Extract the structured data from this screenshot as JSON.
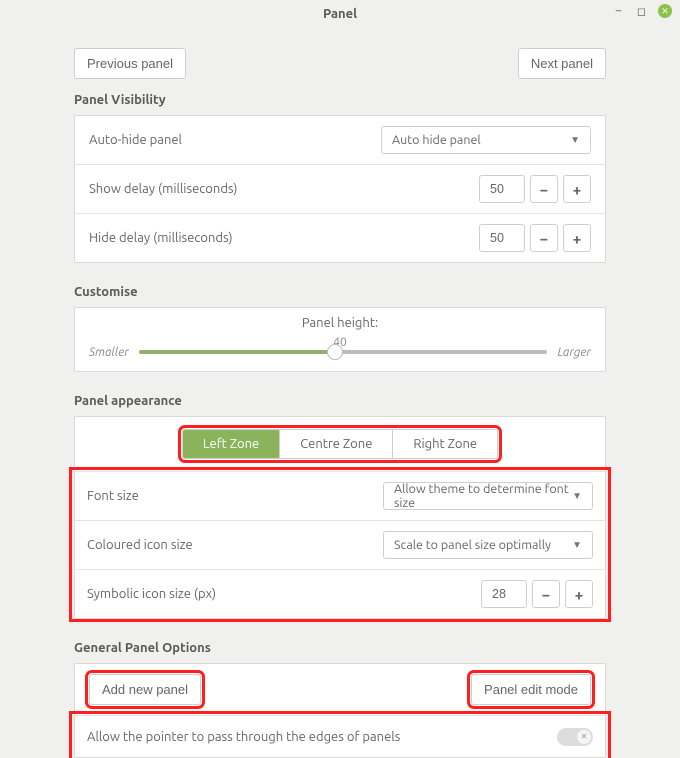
{
  "window": {
    "title": "Panel"
  },
  "nav": {
    "prev": "Previous panel",
    "next": "Next panel"
  },
  "visibility": {
    "heading": "Panel Visibility",
    "autohide_label": "Auto-hide panel",
    "autohide_value": "Auto hide panel",
    "show_delay_label": "Show delay (milliseconds)",
    "show_delay_value": "50",
    "hide_delay_label": "Hide delay (milliseconds)",
    "hide_delay_value": "50"
  },
  "customise": {
    "heading": "Customise",
    "slider_title": "Panel height:",
    "slider_value": "40",
    "smaller": "Smaller",
    "larger": "Larger"
  },
  "appearance": {
    "heading": "Panel appearance",
    "tabs": {
      "left": "Left Zone",
      "centre": "Centre Zone",
      "right": "Right Zone"
    },
    "font_size_label": "Font size",
    "font_size_value": "Allow theme to determine font size",
    "col_icon_label": "Coloured icon size",
    "col_icon_value": "Scale to panel size optimally",
    "sym_icon_label": "Symbolic icon size (px)",
    "sym_icon_value": "28"
  },
  "general": {
    "heading": "General Panel Options",
    "add_panel": "Add new panel",
    "edit_mode": "Panel edit mode",
    "pointer_label": "Allow the pointer to pass through the edges of panels"
  }
}
